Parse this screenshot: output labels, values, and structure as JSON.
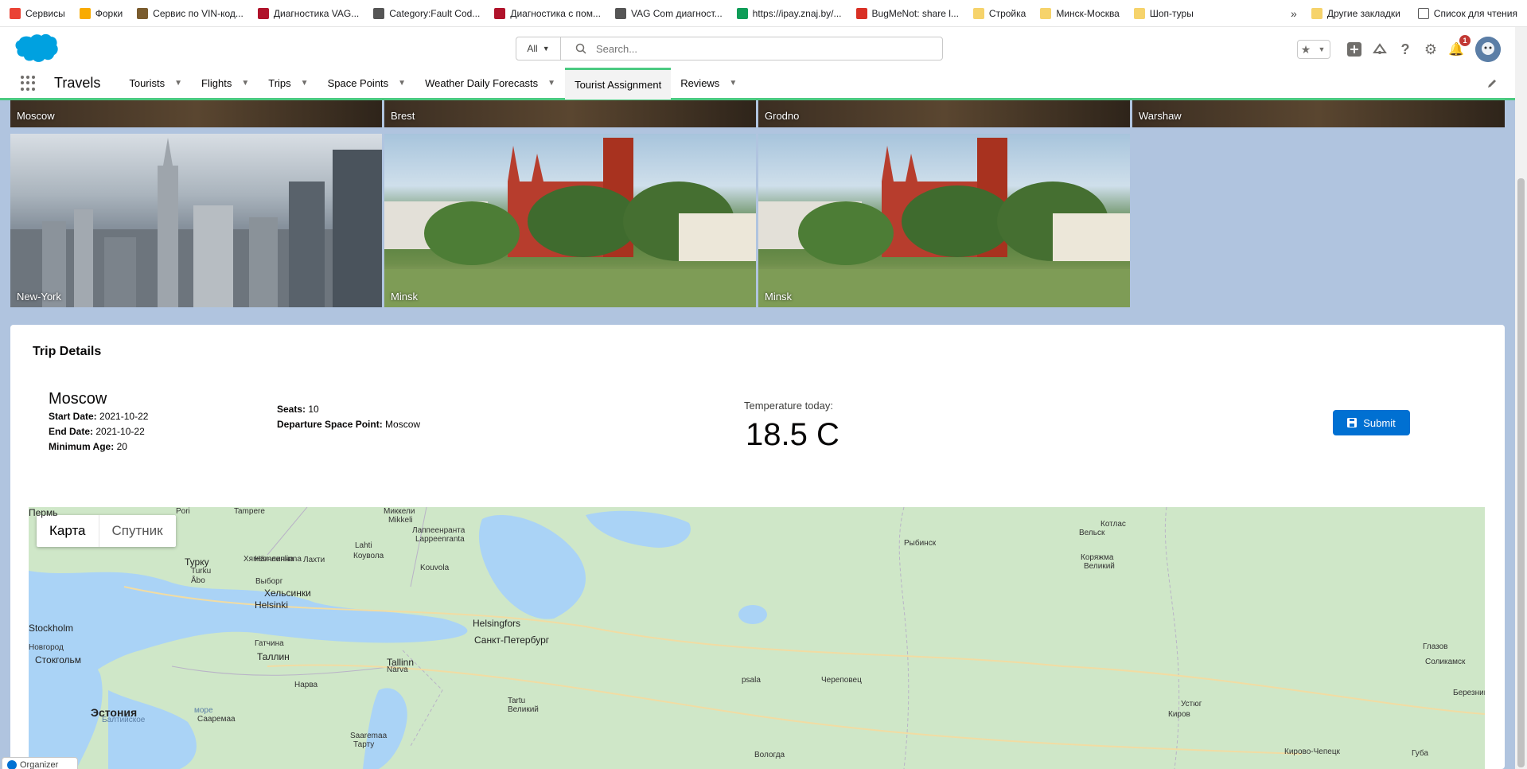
{
  "bookmarks": {
    "items": [
      {
        "label": "Сервисы",
        "color": "#ea4335"
      },
      {
        "label": "Форки",
        "color": "#f9ab00"
      },
      {
        "label": "Сервис по VIN-код...",
        "color": "#7a5c2e"
      },
      {
        "label": "Диагностика VAG...",
        "color": "#b0132b"
      },
      {
        "label": "Category:Fault Cod...",
        "color": "#555555"
      },
      {
        "label": "Диагностика с пом...",
        "color": "#b0132b"
      },
      {
        "label": "VAG Com диагност...",
        "color": "#555555"
      },
      {
        "label": "https://ipay.znaj.by/...",
        "color": "#0f9d58"
      },
      {
        "label": "BugMeNot: share l...",
        "color": "#d93025"
      },
      {
        "label": "Стройка",
        "color": "#f6d36b"
      },
      {
        "label": "Минск-Москва",
        "color": "#f6d36b"
      },
      {
        "label": "Шоп-туры",
        "color": "#f6d36b"
      }
    ],
    "more": "»",
    "other": "Другие закладки",
    "reading_list": "Список для чтения"
  },
  "header": {
    "search_scope": "All",
    "search_placeholder": "Search...",
    "notification_count": "1"
  },
  "nav": {
    "app_name": "Travels",
    "items": [
      {
        "label": "Tourists"
      },
      {
        "label": "Flights"
      },
      {
        "label": "Trips"
      },
      {
        "label": "Space Points"
      },
      {
        "label": "Weather Daily Forecasts"
      },
      {
        "label": "Tourist Assignment"
      },
      {
        "label": "Reviews"
      }
    ],
    "active": "Tourist Assignment"
  },
  "tiles": {
    "top": [
      "Moscow",
      "Brest",
      "Grodno",
      "Warshaw"
    ],
    "bottom": [
      "New-York",
      "Minsk",
      "Minsk"
    ]
  },
  "trip": {
    "card_title": "Trip Details",
    "city": "Moscow",
    "start_date_label": "Start Date:",
    "start_date": "2021-10-22",
    "end_date_label": "End Date:",
    "end_date": "2021-10-22",
    "min_age_label": "Minimum Age:",
    "min_age": "20",
    "seats_label": "Seats:",
    "seats": "10",
    "departure_label": "Departure Space Point:",
    "departure": "Moscow",
    "temp_label": "Temperature today:",
    "temp_value": "18.5 C",
    "submit": "Submit"
  },
  "map": {
    "toggle_map": "Карта",
    "toggle_satellite": "Спутник",
    "labels": [
      {
        "text": "Pori",
        "cls": ""
      },
      {
        "text": "Tampere",
        "cls": ""
      },
      {
        "text": "Миккели",
        "cls": ""
      },
      {
        "text": "Mikkeli",
        "cls": ""
      },
      {
        "text": "Лаппеенранта",
        "cls": ""
      },
      {
        "text": "Lappeenranta",
        "cls": ""
      },
      {
        "text": "Турку",
        "cls": "mid"
      },
      {
        "text": "Turku",
        "cls": ""
      },
      {
        "text": "Åbo",
        "cls": ""
      },
      {
        "text": "Хямеэнлинна",
        "cls": ""
      },
      {
        "text": "Hämeenlinna",
        "cls": ""
      },
      {
        "text": "Лахти",
        "cls": ""
      },
      {
        "text": "Lahti",
        "cls": ""
      },
      {
        "text": "Коувола",
        "cls": ""
      },
      {
        "text": "Kouvola",
        "cls": ""
      },
      {
        "text": "Выборг",
        "cls": ""
      },
      {
        "text": "Хельсинки",
        "cls": "mid"
      },
      {
        "text": "Helsinki",
        "cls": "mid"
      },
      {
        "text": "Helsingfors",
        "cls": "mid"
      },
      {
        "text": "Санкт-Петербург",
        "cls": "mid"
      },
      {
        "text": "Гатчина",
        "cls": ""
      },
      {
        "text": "Таллин",
        "cls": "mid"
      },
      {
        "text": "Tallinn",
        "cls": "mid"
      },
      {
        "text": "Narva",
        "cls": ""
      },
      {
        "text": "Нарва",
        "cls": ""
      },
      {
        "text": "Эстония",
        "cls": "big"
      },
      {
        "text": "Балтийское",
        "cls": "sea"
      },
      {
        "text": "море",
        "cls": "sea"
      },
      {
        "text": "Сааремаа",
        "cls": ""
      },
      {
        "text": "Saaremaa",
        "cls": ""
      },
      {
        "text": "Тарту",
        "cls": ""
      },
      {
        "text": "Tartu",
        "cls": ""
      },
      {
        "text": "Великий",
        "cls": ""
      },
      {
        "text": "Новгород",
        "cls": ""
      },
      {
        "text": "Стокгольм",
        "cls": "mid"
      },
      {
        "text": "Stockholm",
        "cls": "mid"
      },
      {
        "text": "psala",
        "cls": ""
      },
      {
        "text": "Череповец",
        "cls": ""
      },
      {
        "text": "Вологда",
        "cls": ""
      },
      {
        "text": "Рыбинск",
        "cls": ""
      },
      {
        "text": "Вельск",
        "cls": ""
      },
      {
        "text": "Котлас",
        "cls": ""
      },
      {
        "text": "Коряжма",
        "cls": ""
      },
      {
        "text": "Великий",
        "cls": ""
      },
      {
        "text": "Устюг",
        "cls": ""
      },
      {
        "text": "Киров",
        "cls": ""
      },
      {
        "text": "Кирово-Чепецк",
        "cls": ""
      },
      {
        "text": "Глазов",
        "cls": ""
      },
      {
        "text": "Соликамск",
        "cls": ""
      },
      {
        "text": "Березники",
        "cls": ""
      },
      {
        "text": "Губа",
        "cls": ""
      },
      {
        "text": "Пермь",
        "cls": "mid"
      }
    ]
  },
  "organizer": "Organizer"
}
